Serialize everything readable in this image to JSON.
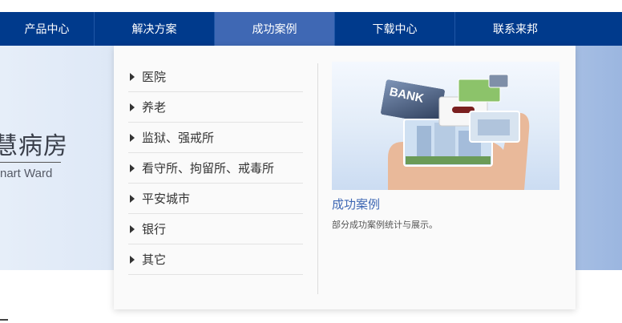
{
  "nav": {
    "items": [
      {
        "label": "产品中心"
      },
      {
        "label": "解决方案"
      },
      {
        "label": "成功案例"
      },
      {
        "label": "下载中心"
      },
      {
        "label": "联系来邦"
      }
    ],
    "active_index": 2,
    "bg_color": "#003a8c",
    "active_color": "#3f68b4"
  },
  "banner": {
    "title": "慧病房",
    "subtitle": "nart Ward"
  },
  "dropdown": {
    "menu": [
      {
        "label": "医院"
      },
      {
        "label": "养老"
      },
      {
        "label": "监狱、强戒所"
      },
      {
        "label": "看守所、拘留所、戒毒所"
      },
      {
        "label": "平安城市"
      },
      {
        "label": "银行"
      },
      {
        "label": "其它"
      }
    ],
    "image_text": "BANK",
    "promo_title": "成功案例",
    "promo_desc": "部分成功案例统计与展示。"
  }
}
